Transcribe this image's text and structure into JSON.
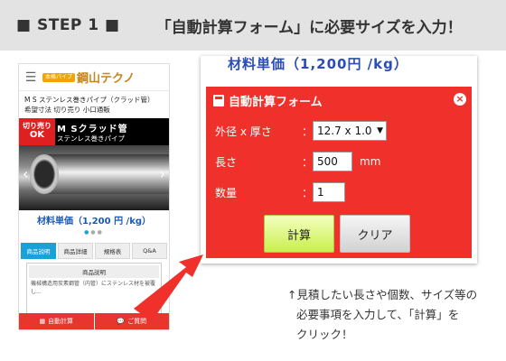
{
  "step": {
    "label": "■ STEP 1 ■",
    "heading": "「自動計算フォーム」に必要サイズを入力！"
  },
  "phone": {
    "menu_icon": "hamburger-icon",
    "logo_badge": "本格パイプ",
    "logo_text": "鋼山テクノ",
    "title_line1": "M S ステンレス巻きパイプ（クラッド管）",
    "title_line2": "希望寸法 切り売り 小口通販",
    "hero_badge_line1": "切り売り",
    "hero_badge_line2": "OK",
    "hero_name": "M Sクラッド管",
    "hero_sub": "ステンレス巻きパイプ",
    "price": "材料単価（1,200 円 /kg）",
    "tabs": [
      "商品説明",
      "商品詳細",
      "規格表",
      "Q&A"
    ],
    "desc_title": "商品説明",
    "desc_text": "機械構造用炭素鋼管（内管）にステンレス材を被覆し...",
    "footer_calc": "自動計算",
    "footer_question": "ご質問"
  },
  "form": {
    "partial_price": "材料単価（1,200円 /kg）",
    "title": "自動計算フォーム",
    "fields": {
      "diameter_label": "外径 x 厚さ",
      "diameter_value": "12.7 x 1.0",
      "length_label": "長さ",
      "length_value": "500",
      "length_unit": "mm",
      "qty_label": "数量",
      "qty_value": "1"
    },
    "colon": "：",
    "calc_button": "計算",
    "clear_button": "クリア"
  },
  "caption": {
    "line1": "↑見積したい長さや個数、サイズ等の",
    "line2": "必要事項を入力して、「計算」を",
    "line3": "クリック！"
  },
  "colors": {
    "accent_red": "#f0302a",
    "calc_green": "#c9ef4d",
    "price_blue": "#1a59b7"
  }
}
